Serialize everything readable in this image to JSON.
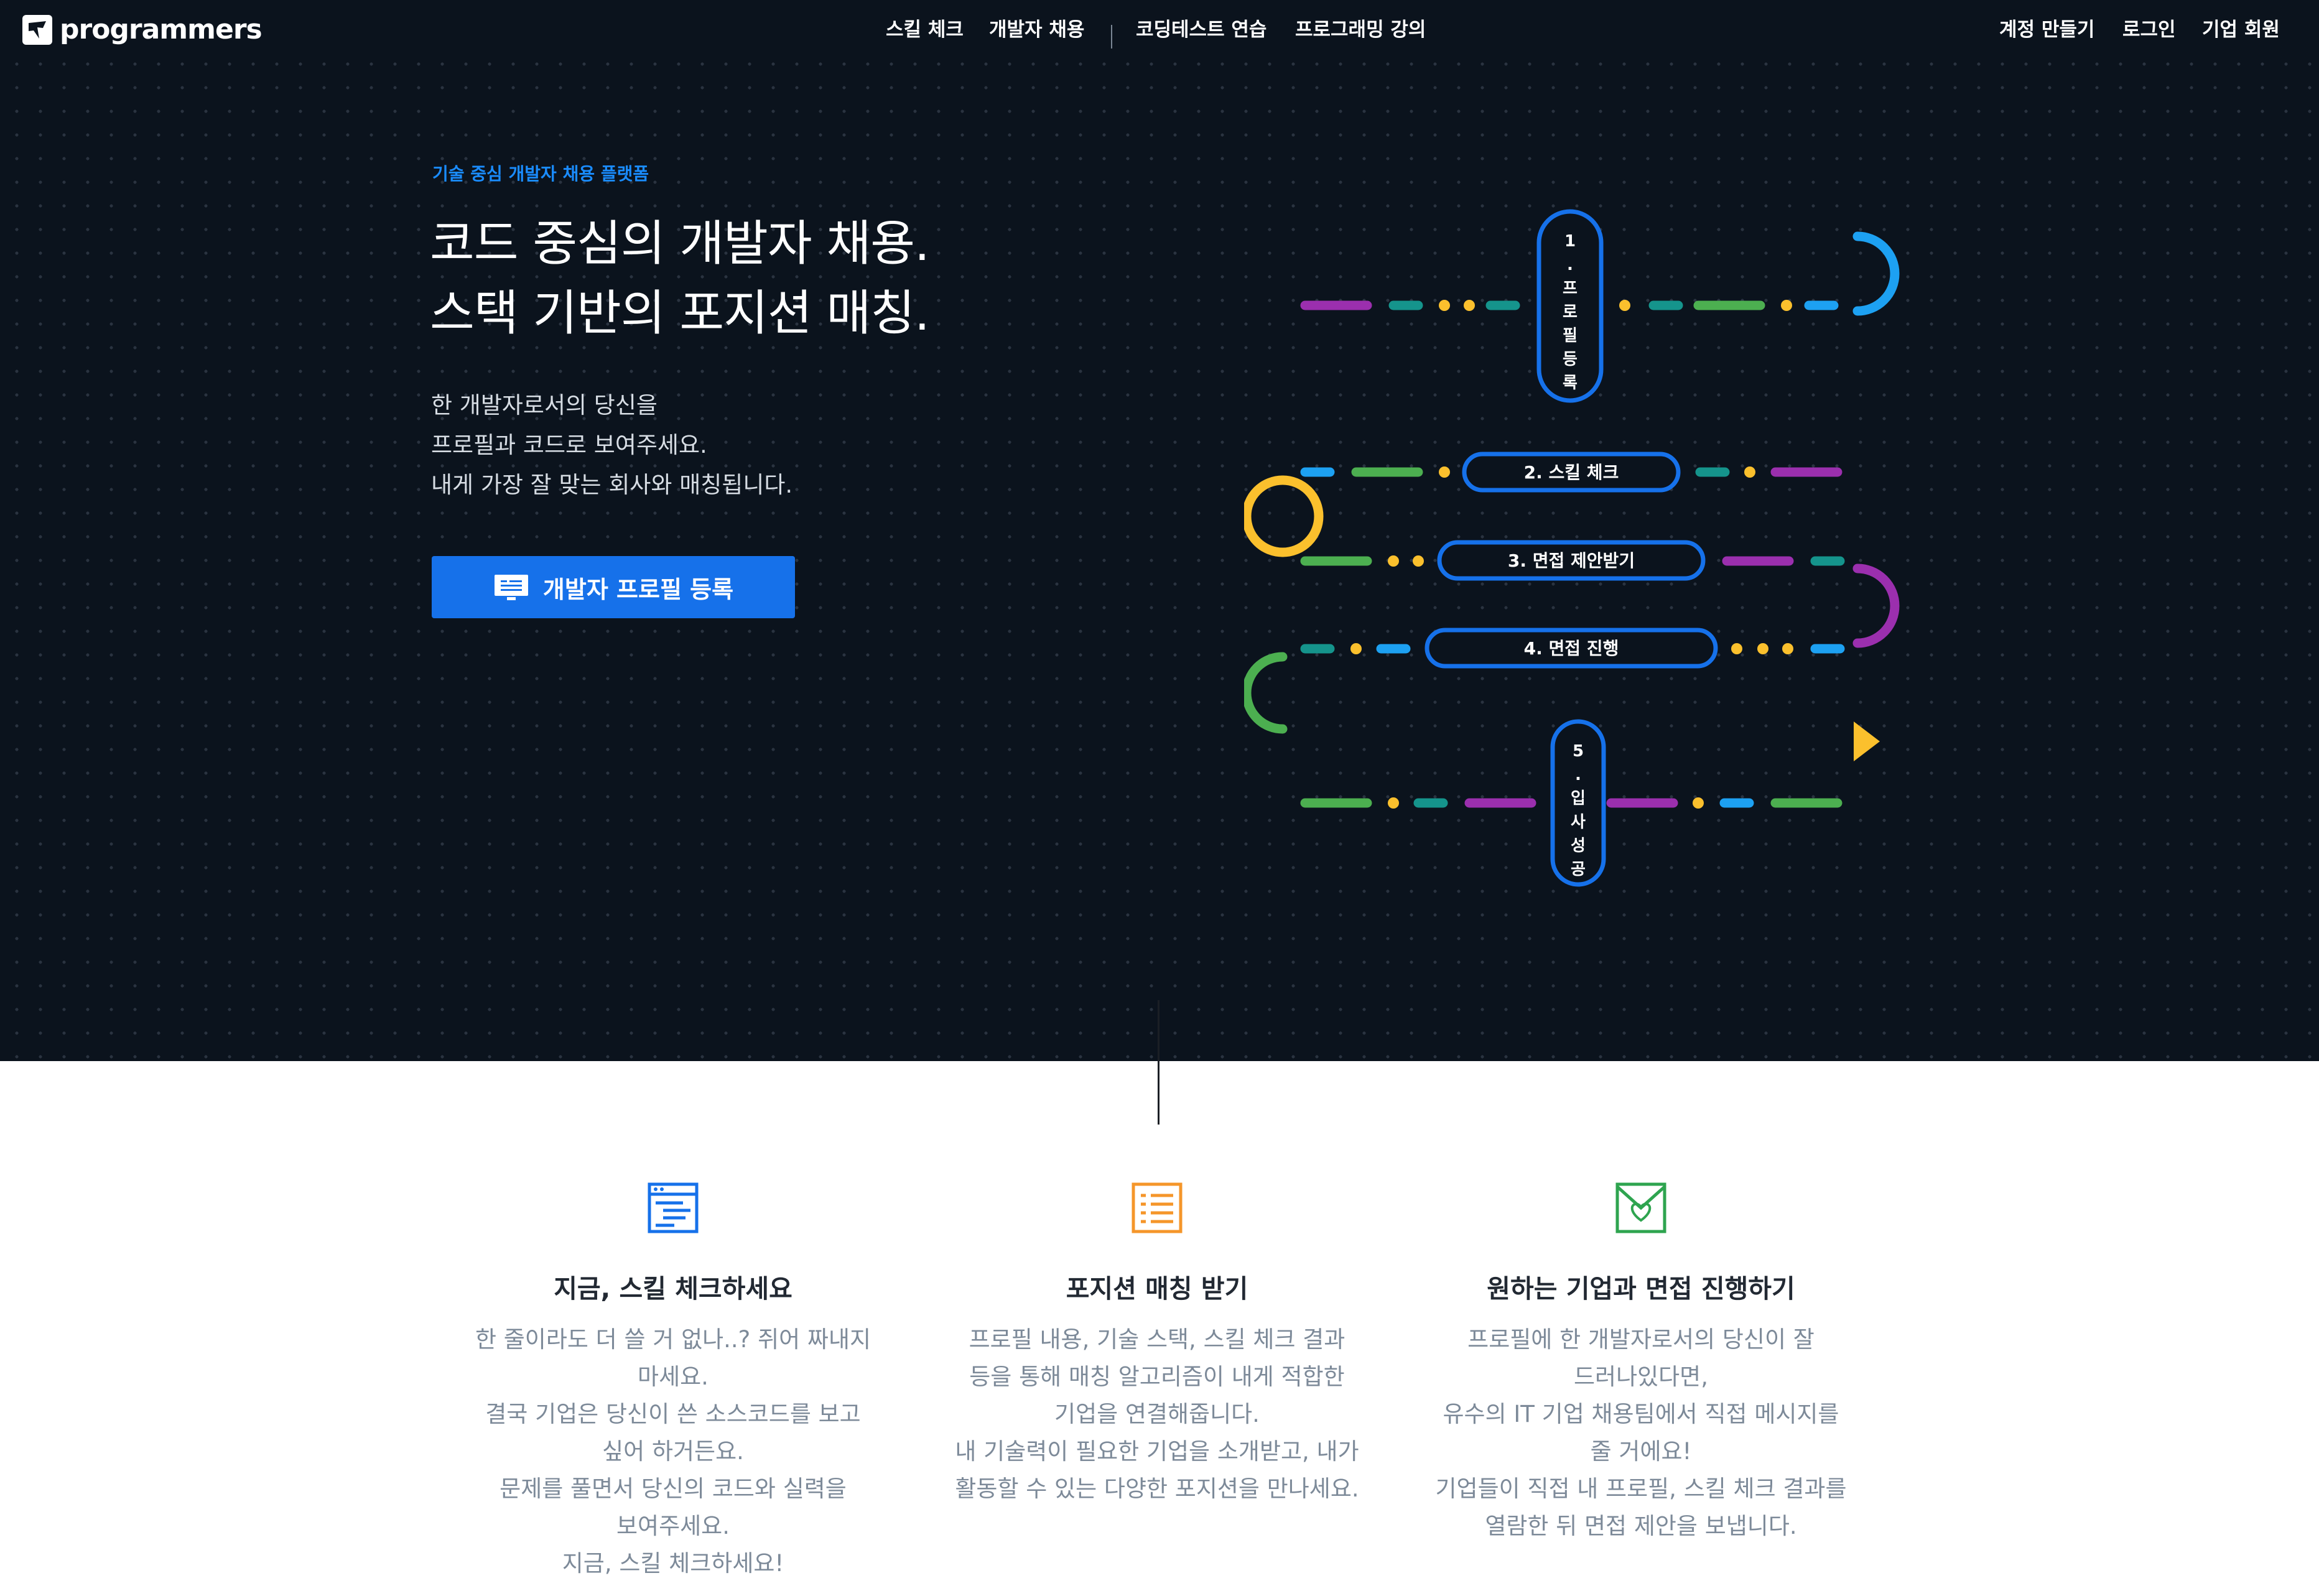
{
  "brand": {
    "name": "programmers"
  },
  "nav": {
    "left": [
      {
        "label": "스킬 체크"
      },
      {
        "label": "개발자 채용"
      }
    ],
    "middle": [
      {
        "label": "코딩테스트 연습"
      },
      {
        "label": "프로그래밍 강의"
      }
    ],
    "right": [
      {
        "label": "계정 만들기"
      },
      {
        "label": "로그인"
      },
      {
        "label": "기업 회원"
      }
    ]
  },
  "hero": {
    "eyebrow": "기술 중심 개발자 채용 플랫폼",
    "headline": [
      "코드 중심의 개발자 채용.",
      "스택 기반의 포지션 매칭."
    ],
    "lede": [
      "한 개발자로서의 당신을",
      "프로필과 코드로 보여주세요.",
      "내게 가장 잘 맞는 회사와 매칭됩니다."
    ],
    "cta_label": "개발자 프로필 등록"
  },
  "steps": [
    {
      "label": "1. 프로필 등록",
      "vertical": [
        "1",
        ".",
        "프",
        "로",
        "필",
        "등",
        "록"
      ]
    },
    {
      "label": "2. 스킬 체크"
    },
    {
      "label": "3. 면접 제안받기"
    },
    {
      "label": "4. 면접 진행"
    },
    {
      "label": "5. 입사 성공",
      "vertical": [
        "5",
        ".",
        "입",
        "사",
        "성",
        "공"
      ]
    }
  ],
  "colors": {
    "accent": "#1671ea",
    "purple": "#9b2fae",
    "teal": "#15948c",
    "green": "#4caf50",
    "yellow": "#fbc02d",
    "blue": "#1da1f2"
  },
  "features": [
    {
      "icon": "code-window-icon",
      "title": "지금, 스킬 체크하세요",
      "desc": [
        "한 줄이라도 더 쓸 거 없나..? 쥐어 짜내지",
        "마세요.",
        "결국 기업은 당신이 쓴 소스코드를 보고",
        "싶어 하거든요.",
        "문제를 풀면서 당신의 코드와 실력을",
        "보여주세요.",
        "지금, 스킬 체크하세요!"
      ]
    },
    {
      "icon": "checklist-icon",
      "title": "포지션 매칭 받기",
      "desc": [
        "프로필 내용, 기술 스택, 스킬 체크 결과",
        "등을 통해 매칭 알고리즘이 내게 적합한",
        "기업을 연결해줍니다.",
        "내 기술력이 필요한 기업을 소개받고, 내가",
        "활동할 수 있는 다양한 포지션을 만나세요."
      ]
    },
    {
      "icon": "heart-envelope-icon",
      "title": "원하는 기업과 면접 진행하기",
      "desc": [
        "프로필에 한 개발자로서의 당신이 잘",
        "드러나있다면,",
        "유수의 IT 기업 채용팀에서 직접 메시지를",
        "줄 거에요!",
        "기업들이 직접 내 프로필, 스킬 체크 결과를",
        "열람한 뒤 면접 제안을 보냅니다."
      ]
    }
  ]
}
